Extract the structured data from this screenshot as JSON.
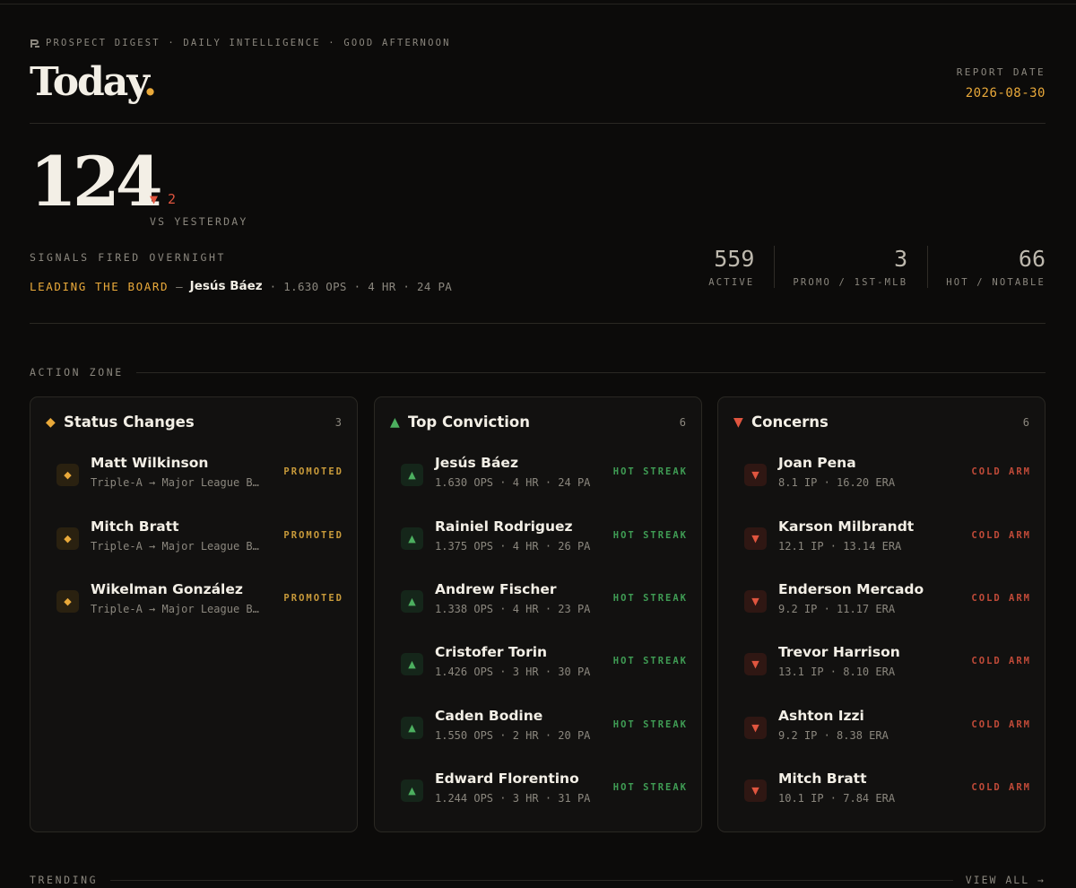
{
  "header": {
    "eyebrow": "PROSPECT DIGEST · DAILY INTELLIGENCE · GOOD AFTERNOON",
    "title": "Today",
    "title_dot": ".",
    "report_label": "REPORT DATE",
    "report_date": "2026-08-30"
  },
  "summary": {
    "signal_count": "124",
    "delta": "▼ 2",
    "delta_label": "VS YESTERDAY",
    "signals_label": "SIGNALS FIRED OVERNIGHT",
    "leading_label": "LEADING THE BOARD",
    "leading_dash": "—",
    "leading_name": "Jesús Báez",
    "leading_stats": "· 1.630 OPS · 4 HR · 24 PA"
  },
  "stats": [
    {
      "value": "559",
      "label": "ACTIVE"
    },
    {
      "value": "3",
      "label": "PROMO / 1ST-MLB"
    },
    {
      "value": "66",
      "label": "HOT / NOTABLE"
    }
  ],
  "action_zone": {
    "label": "ACTION ZONE"
  },
  "trending": {
    "label": "TRENDING",
    "view_all": "VIEW ALL →"
  },
  "cards": {
    "status": {
      "icon": "◆",
      "title": "Status Changes",
      "count": "3",
      "items": [
        {
          "icon": "◆",
          "name": "Matt Wilkinson",
          "sub": "Triple-A → Major League Baseball",
          "tag": "PROMOTED"
        },
        {
          "icon": "◆",
          "name": "Mitch Bratt",
          "sub": "Triple-A → Major League Baseball",
          "tag": "PROMOTED"
        },
        {
          "icon": "◆",
          "name": "Wikelman González",
          "sub": "Triple-A → Major League Baseball",
          "tag": "PROMOTED"
        }
      ]
    },
    "conviction": {
      "icon": "▲",
      "title": "Top Conviction",
      "count": "6",
      "items": [
        {
          "icon": "▲",
          "name": "Jesús Báez",
          "sub": "1.630 OPS · 4 HR · 24 PA",
          "tag": "HOT STREAK"
        },
        {
          "icon": "▲",
          "name": "Rainiel Rodriguez",
          "sub": "1.375 OPS · 4 HR · 26 PA",
          "tag": "HOT STREAK"
        },
        {
          "icon": "▲",
          "name": "Andrew Fischer",
          "sub": "1.338 OPS · 4 HR · 23 PA",
          "tag": "HOT STREAK"
        },
        {
          "icon": "▲",
          "name": "Cristofer Torin",
          "sub": "1.426 OPS · 3 HR · 30 PA",
          "tag": "HOT STREAK"
        },
        {
          "icon": "▲",
          "name": "Caden Bodine",
          "sub": "1.550 OPS · 2 HR · 20 PA",
          "tag": "HOT STREAK"
        },
        {
          "icon": "▲",
          "name": "Edward Florentino",
          "sub": "1.244 OPS · 3 HR · 31 PA",
          "tag": "HOT STREAK"
        }
      ]
    },
    "concerns": {
      "icon": "▼",
      "title": "Concerns",
      "count": "6",
      "items": [
        {
          "icon": "▼",
          "name": "Joan Pena",
          "sub": "8.1 IP · 16.20 ERA",
          "tag": "COLD ARM"
        },
        {
          "icon": "▼",
          "name": "Karson Milbrandt",
          "sub": "12.1 IP · 13.14 ERA",
          "tag": "COLD ARM"
        },
        {
          "icon": "▼",
          "name": "Enderson Mercado",
          "sub": "9.2 IP · 11.17 ERA",
          "tag": "COLD ARM"
        },
        {
          "icon": "▼",
          "name": "Trevor Harrison",
          "sub": "13.1 IP · 8.10 ERA",
          "tag": "COLD ARM"
        },
        {
          "icon": "▼",
          "name": "Ashton Izzi",
          "sub": "9.2 IP · 8.38 ERA",
          "tag": "COLD ARM"
        },
        {
          "icon": "▼",
          "name": "Mitch Bratt",
          "sub": "10.1 IP · 7.84 ERA",
          "tag": "COLD ARM"
        }
      ]
    }
  },
  "colors": {
    "accent": "#e9a93a",
    "positive": "#4caf5f",
    "negative": "#e0553f",
    "background": "#0c0b0a"
  }
}
